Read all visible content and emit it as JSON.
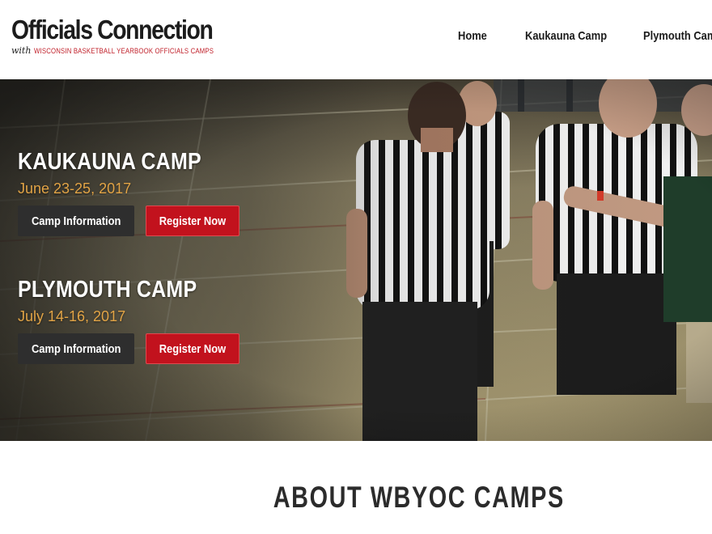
{
  "logo": {
    "title": "Officials Connection",
    "with": "with",
    "tagline": "WISCONSIN BASKETBALL YEARBOOK OFFICIALS CAMPS"
  },
  "nav": {
    "items": [
      {
        "label": "Home"
      },
      {
        "label": "Kaukauna Camp"
      },
      {
        "label": "Plymouth Camp"
      }
    ]
  },
  "hero": {
    "camps": [
      {
        "title": "KAUKAUNA CAMP",
        "date": "June 23-25, 2017",
        "info_label": "Camp Information",
        "register_label": "Register Now"
      },
      {
        "title": "PLYMOUTH CAMP",
        "date": "July 14-16, 2017",
        "info_label": "Camp Information",
        "register_label": "Register Now"
      }
    ]
  },
  "about": {
    "title": "ABOUT WBYOC CAMPS"
  },
  "colors": {
    "accent_red": "#c2121d",
    "date_gold": "#e2a446",
    "dark_button": "#2e2e2e"
  }
}
